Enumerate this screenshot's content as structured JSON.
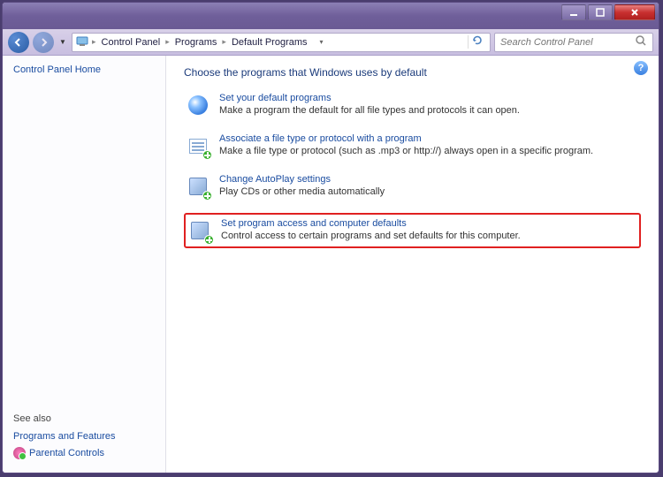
{
  "breadcrumb": [
    "Control Panel",
    "Programs",
    "Default Programs"
  ],
  "search_placeholder": "Search Control Panel",
  "sidebar": {
    "home": "Control Panel Home",
    "see_also": "See also",
    "links": [
      "Programs and Features",
      "Parental Controls"
    ]
  },
  "main": {
    "heading": "Choose the programs that Windows uses by default",
    "items": [
      {
        "title": "Set your default programs",
        "desc": "Make a program the default for all file types and protocols it can open.",
        "highlighted": false
      },
      {
        "title": "Associate a file type or protocol with a program",
        "desc": "Make a file type or protocol (such as .mp3 or http://) always open in a specific program.",
        "highlighted": false
      },
      {
        "title": "Change AutoPlay settings",
        "desc": "Play CDs or other media automatically",
        "highlighted": false
      },
      {
        "title": "Set program access and computer defaults",
        "desc": "Control access to certain programs and set defaults for this computer.",
        "highlighted": true
      }
    ]
  }
}
